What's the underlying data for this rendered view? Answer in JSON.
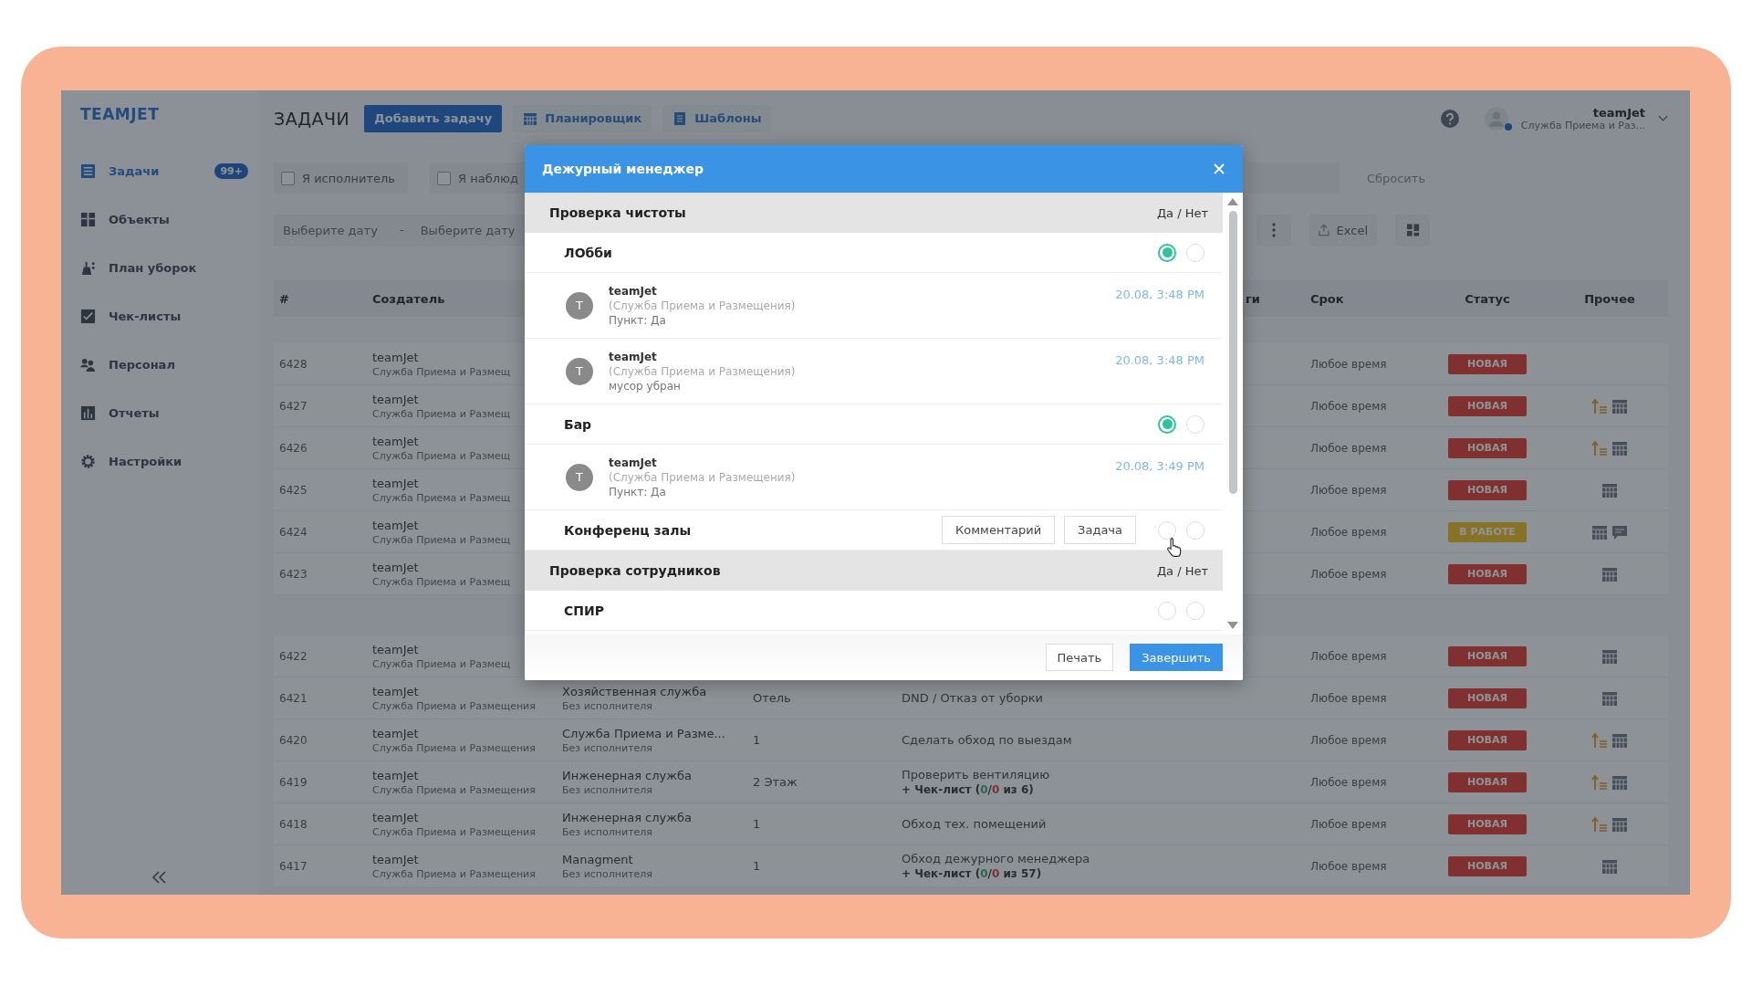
{
  "app": {
    "logo": "TEAMJET"
  },
  "sidebar": {
    "items": [
      {
        "label": "Задачи",
        "kind": "tasks",
        "selected": true,
        "badge": "99+"
      },
      {
        "label": "Объекты",
        "kind": "objects",
        "selected": false
      },
      {
        "label": "План уборок",
        "kind": "cleaning",
        "selected": false
      },
      {
        "label": "Чек-листы",
        "kind": "checklists",
        "selected": false
      },
      {
        "label": "Персонал",
        "kind": "staff",
        "selected": false
      },
      {
        "label": "Отчеты",
        "kind": "reports",
        "selected": false
      },
      {
        "label": "Настройки",
        "kind": "settings",
        "selected": false
      }
    ]
  },
  "header": {
    "title": "ЗАДАЧИ",
    "add_button": "Добавить задачу",
    "tabs": [
      {
        "label": "Планировщик",
        "kind": "calendar"
      },
      {
        "label": "Шаблоны",
        "kind": "templates"
      }
    ],
    "user": {
      "name": "teamJet",
      "role": "Служба Приема и Раз...",
      "online": true
    }
  },
  "filters": {
    "checkboxes": [
      {
        "label": "Я исполнитель",
        "checked": false
      },
      {
        "label": "Я наблюд",
        "checked": false
      }
    ],
    "reset": "Сбросить",
    "dates": [
      {
        "placeholder": "Выберите дату"
      },
      {
        "placeholder": "Выберите дату"
      }
    ],
    "date_separator": "-",
    "export": "Excel"
  },
  "table": {
    "columns": {
      "number": "#",
      "creator": "Создатель",
      "column_5": "ги",
      "deadline": "Срок",
      "status": "Статус",
      "other": "Прочее"
    },
    "groups": [
      {
        "rows": [
          {
            "id": "6428",
            "creator": "teamJet",
            "creator_dept": "Служба Приема и Размещ",
            "deadline": "Любое время",
            "status": {
              "label": "НОВАЯ",
              "kind": "new"
            }
          },
          {
            "id": "6427",
            "creator": "teamJet",
            "creator_dept": "Служба Приема и Размещ",
            "deadline": "Любое время",
            "status": {
              "label": "НОВАЯ",
              "kind": "new"
            },
            "icons": [
              {
                "kind": "priority"
              },
              {
                "kind": "calendar"
              }
            ]
          },
          {
            "id": "6426",
            "creator": "teamJet",
            "creator_dept": "Служба Приема и Размещ",
            "deadline": "Любое время",
            "status": {
              "label": "НОВАЯ",
              "kind": "new"
            },
            "icons": [
              {
                "kind": "priority"
              },
              {
                "kind": "calendar"
              }
            ]
          },
          {
            "id": "6425",
            "creator": "teamJet",
            "creator_dept": "Служба Приема и Размещ",
            "deadline": "Любое время",
            "status": {
              "label": "НОВАЯ",
              "kind": "new"
            },
            "icons": [
              {
                "kind": "calendar"
              }
            ]
          },
          {
            "id": "6424",
            "creator": "teamJet",
            "creator_dept": "Служба Приема и Размещ",
            "deadline": "Любое время",
            "status": {
              "label": "В РАБОТЕ",
              "kind": "in_progress"
            },
            "icons": [
              {
                "kind": "calendar"
              },
              {
                "kind": "comment"
              }
            ]
          },
          {
            "id": "6423",
            "creator": "teamJet",
            "creator_dept": "Служба Приема и Размещ",
            "deadline": "Любое время",
            "status": {
              "label": "НОВАЯ",
              "kind": "new"
            },
            "icons": [
              {
                "kind": "calendar"
              }
            ]
          }
        ]
      },
      {
        "rows": [
          {
            "id": "6422",
            "creator": "teamJet",
            "creator_dept": "Служба Приема и Размещ",
            "deadline": "Любое время",
            "status": {
              "label": "НОВАЯ",
              "kind": "new"
            },
            "icons": [
              {
                "kind": "calendar"
              }
            ]
          },
          {
            "id": "6421",
            "creator": "teamJet",
            "creator_dept": "Служба Приема и Размещения",
            "executor": "Хозяйственная служба",
            "executor_note": "Без исполнителя",
            "location": "Отель",
            "description": "DND / Отказ от уборки",
            "deadline": "Любое время",
            "status": {
              "label": "НОВАЯ",
              "kind": "new"
            },
            "icons": [
              {
                "kind": "calendar"
              }
            ]
          },
          {
            "id": "6420",
            "creator": "teamJet",
            "creator_dept": "Служба Приема и Размещения",
            "executor": "Служба Приема и Разме...",
            "executor_note": "Без исполнителя",
            "location": "1",
            "description": "Сделать обход по выездам",
            "deadline": "Любое время",
            "status": {
              "label": "НОВАЯ",
              "kind": "new"
            },
            "icons": [
              {
                "kind": "priority"
              },
              {
                "kind": "calendar"
              }
            ]
          },
          {
            "id": "6419",
            "creator": "teamJet",
            "creator_dept": "Служба Приема и Размещения",
            "executor": "Инженерная служба",
            "executor_note": "Без исполнителя",
            "location": "2 Этаж",
            "description": "Проверить вентиляцию",
            "checklist": {
              "label": "+ Чек-лист (",
              "done": "0",
              "separator": "/",
              "failed": "0",
              "total": " из 6)"
            },
            "deadline": "Любое время",
            "status": {
              "label": "НОВАЯ",
              "kind": "new"
            },
            "icons": [
              {
                "kind": "priority"
              },
              {
                "kind": "calendar"
              }
            ]
          },
          {
            "id": "6418",
            "creator": "teamJet",
            "creator_dept": "Служба Приема и Размещения",
            "executor": "Инженерная служба",
            "executor_note": "Без исполнителя",
            "location": "1",
            "description": "Обход тех. помещений",
            "deadline": "Любое время",
            "status": {
              "label": "НОВАЯ",
              "kind": "new"
            },
            "icons": [
              {
                "kind": "priority"
              },
              {
                "kind": "calendar"
              }
            ]
          },
          {
            "id": "6417",
            "creator": "teamJet",
            "creator_dept": "Служба Приема и Размещения",
            "executor": "Managment",
            "executor_note": "Без исполнителя",
            "location": "1",
            "description": "Обход дежурного менеджера",
            "checklist": {
              "label": "+ Чек-лист (",
              "done": "0",
              "separator": "/",
              "failed": "0",
              "total": " из 57)"
            },
            "deadline": "Любое время",
            "status": {
              "label": "НОВАЯ",
              "kind": "new"
            },
            "icons": [
              {
                "kind": "calendar"
              }
            ]
          }
        ]
      }
    ]
  },
  "modal": {
    "title": "Дежурный менеджер",
    "sections": [
      {
        "title": "Проверка чистоты",
        "answer_header": "Да / Нет",
        "items": [
          {
            "name": "ЛОбби",
            "hovered": false,
            "answers": [
              {
                "selected": true
              },
              {
                "selected": false
              }
            ],
            "comments": [
              {
                "initial": "T",
                "author": "teamJet",
                "department": "(Служба Приема и Размещения)",
                "text": "Пункт: Да",
                "time": "20.08, 3:48 PM"
              },
              {
                "initial": "T",
                "author": "teamJet",
                "department": "(Служба Приема и Размещения)",
                "text": "мусор убран",
                "time": "20.08, 3:48 PM"
              }
            ]
          },
          {
            "name": "Бар",
            "hovered": false,
            "answers": [
              {
                "selected": true
              },
              {
                "selected": false
              }
            ],
            "comments": [
              {
                "initial": "T",
                "author": "teamJet",
                "department": "(Служба Приема и Размещения)",
                "text": "Пункт: Да",
                "time": "20.08, 3:49 PM"
              }
            ]
          },
          {
            "name": "Конференц залы",
            "hovered": true,
            "actions": [
              "Комментарий",
              "Задача"
            ],
            "answers": [
              {
                "selected": false
              },
              {
                "selected": false
              }
            ]
          }
        ]
      },
      {
        "title": "Проверка сотрудников",
        "answer_header": "Да / Нет",
        "items": [
          {
            "name": "СПИР",
            "hovered": false,
            "answers": [
              {
                "selected": false
              },
              {
                "selected": false
              }
            ]
          }
        ]
      }
    ],
    "buttons": [
      {
        "label": "Печать",
        "kind": "secondary"
      },
      {
        "label": "Завершить",
        "kind": "primary"
      }
    ]
  }
}
